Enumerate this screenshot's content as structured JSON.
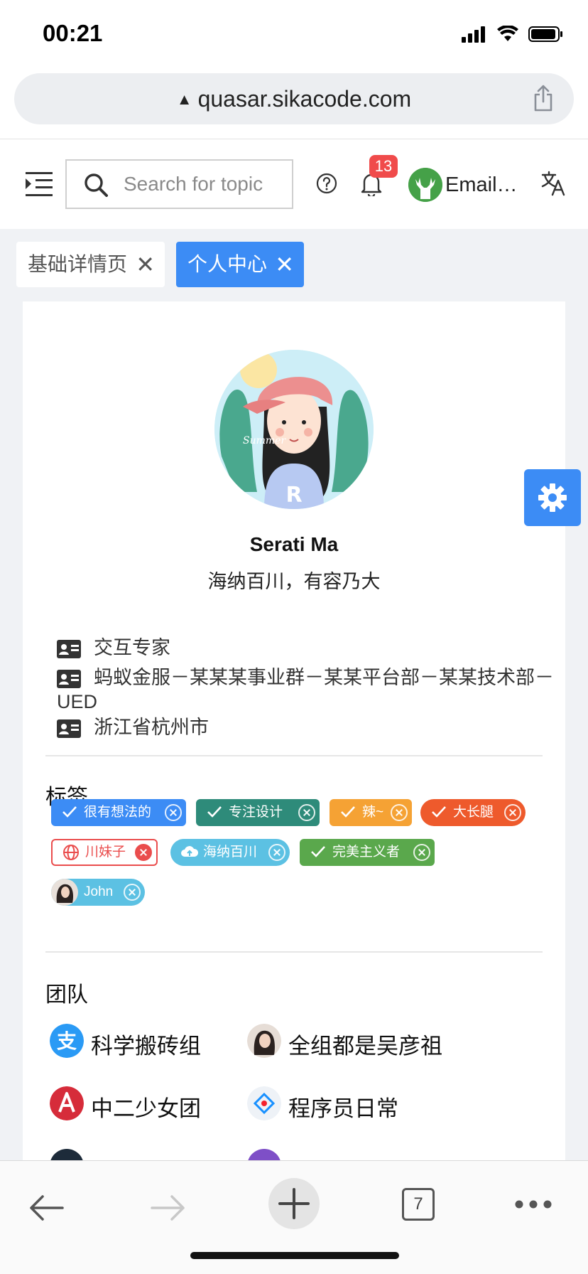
{
  "status_bar": {
    "time": "00:21"
  },
  "browser": {
    "url": "quasar.sikacode.com",
    "tab_count": "7"
  },
  "header": {
    "search_placeholder": "Search for topic",
    "notification_count": "13",
    "user_name": "Email…"
  },
  "tabs": [
    {
      "label": "基础详情页",
      "active": false
    },
    {
      "label": "个人中心",
      "active": true
    }
  ],
  "profile": {
    "avatar_caption": "Summer",
    "name": "Serati Ma",
    "motto": "海纳百川，有容乃大",
    "info": [
      "交互专家",
      "蚂蚁金服－某某某事业群－某某平台部－某某技术部－UED",
      "浙江省杭州市"
    ]
  },
  "tags_section": {
    "title": "标签",
    "tags": [
      {
        "label": "很有想法的",
        "color": "#3c8cf5",
        "icon": "check-icon"
      },
      {
        "label": "专注设计",
        "color": "#2e8b7a",
        "icon": "check-icon"
      },
      {
        "label": "辣~",
        "color": "#f5a234",
        "icon": "check-icon"
      },
      {
        "label": "大长腿",
        "color": "#ee5a2c",
        "icon": "check-icon"
      },
      {
        "label": "川妹子",
        "color": "#ea4d4d",
        "icon": "globe-icon"
      },
      {
        "label": "海纳百川",
        "color": "#5cc1e3",
        "icon": "cloud-upload-icon"
      },
      {
        "label": "完美主义者",
        "color": "#5aa84c",
        "icon": "check-icon"
      },
      {
        "label": "John",
        "color": "#5cc1e3",
        "icon": "avatar"
      }
    ]
  },
  "team_section": {
    "title": "团队",
    "teams": [
      {
        "label": "科学搬砖组",
        "icon": "alipay-icon"
      },
      {
        "label": "全组都是吴彦祖",
        "icon": "avatar"
      },
      {
        "label": "中二少女团",
        "icon": "angular-icon"
      },
      {
        "label": "程序员日常",
        "icon": "antd-icon"
      }
    ]
  },
  "colors": {
    "primary": "#3c8cf5",
    "badge": "#f04b4b",
    "background": "#f0f2f5"
  }
}
